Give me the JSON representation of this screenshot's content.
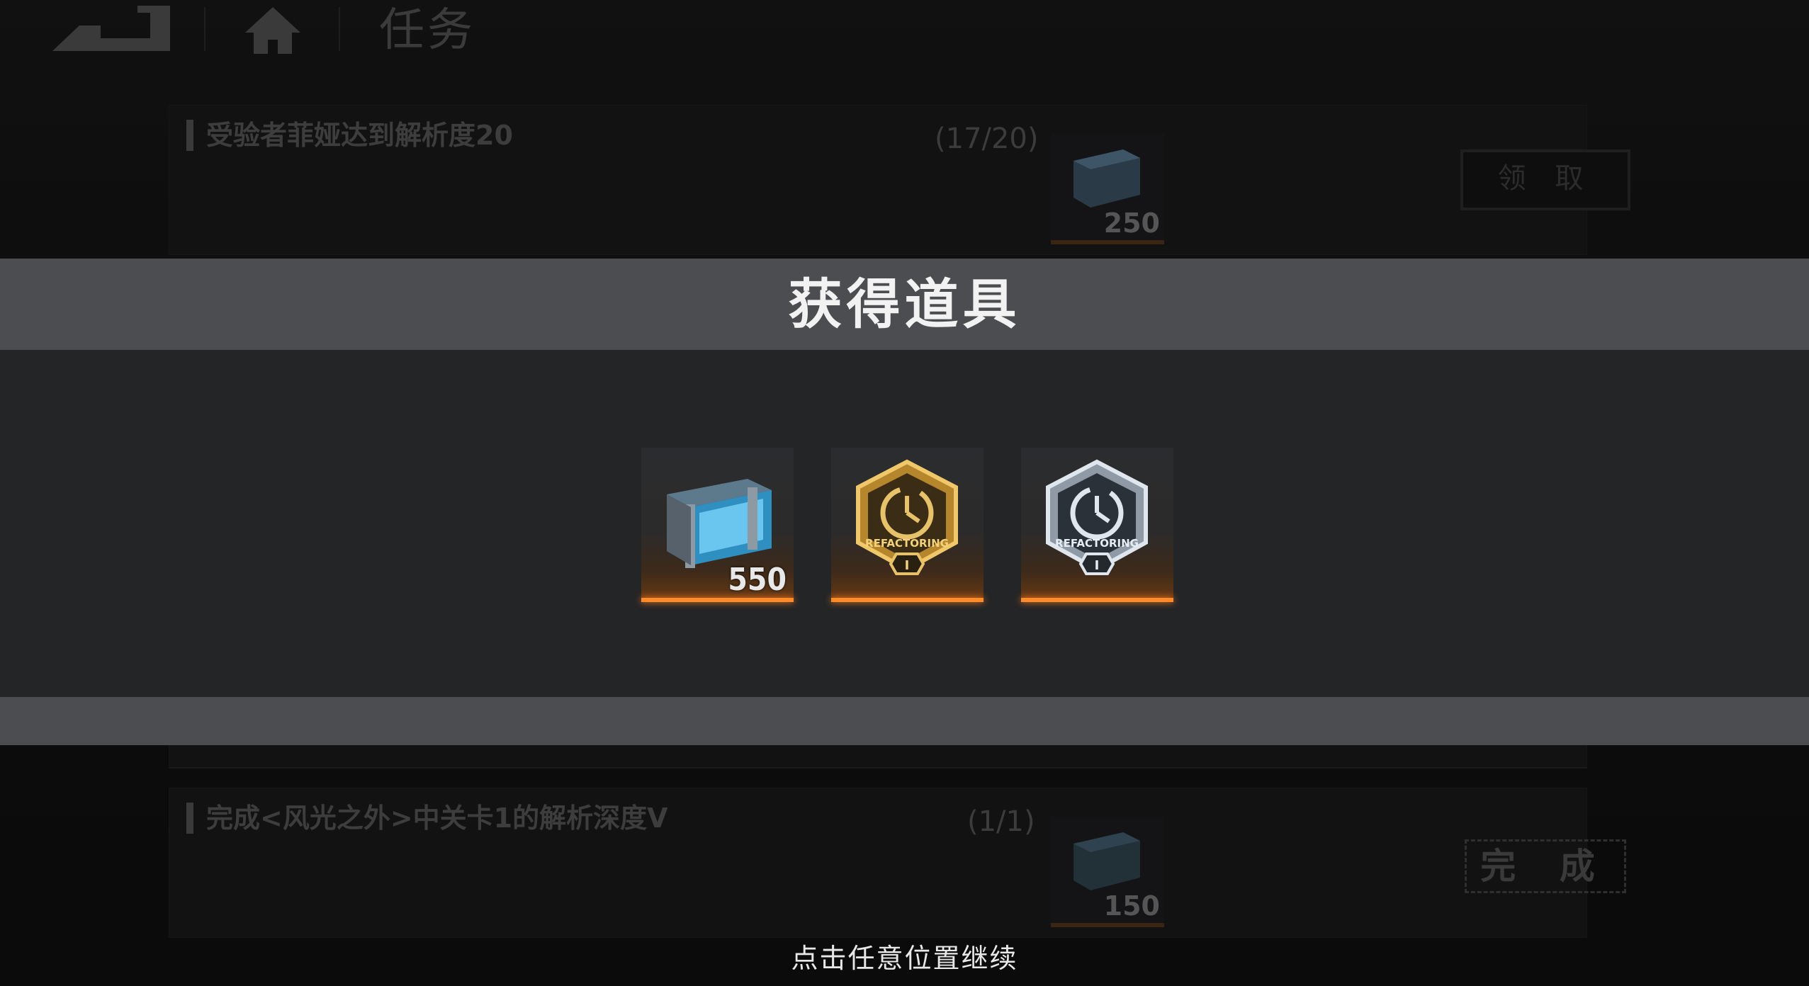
{
  "header": {
    "title": "任务"
  },
  "tasks": [
    {
      "name": "受验者菲娅达到解析度20",
      "progress": "(17/20)",
      "reward_qty": "250",
      "action": "领 取"
    },
    {
      "name": "完成<风光之外>中关卡1的解析深度V",
      "progress": "(1/1)",
      "reward_qty": "150",
      "action": "完 成"
    }
  ],
  "modal": {
    "title": "获得道具",
    "items": [
      {
        "icon": "supply-crate-icon",
        "qty": "550"
      },
      {
        "icon": "gold-refactoring-badge-icon",
        "label": "REFACTORING",
        "tier": "I"
      },
      {
        "icon": "silver-refactoring-badge-icon",
        "label": "REFACTORING",
        "tier": "I"
      }
    ],
    "hint": "点击任意位置继续"
  },
  "colors": {
    "accent": "#ff8a2a",
    "modal_band": "#4b4d50",
    "modal_body": "#242527"
  }
}
